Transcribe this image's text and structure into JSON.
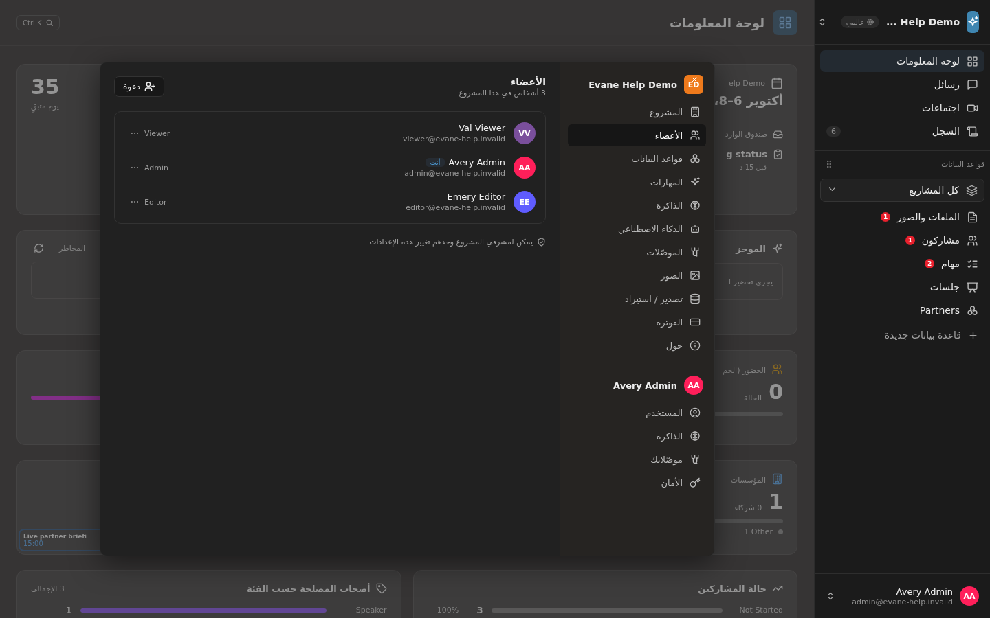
{
  "sidebar": {
    "workspace_name": "... Help Demo",
    "scope_badge": "عالمي",
    "nav": [
      {
        "label": "لوحة المعلومات",
        "selected": true
      },
      {
        "label": "رسائل",
        "selected": false
      },
      {
        "label": "اجتماعات",
        "selected": false
      },
      {
        "label": "السجل",
        "selected": false,
        "count": "6"
      }
    ],
    "databases_title": "قواعد البيانات",
    "project_filter": "كل المشاريع",
    "databases": [
      {
        "label": "الملفات والصور",
        "badge": "1"
      },
      {
        "label": "مشاركون",
        "badge": "1"
      },
      {
        "label": "مهام",
        "badge": "2"
      },
      {
        "label": "جلسات"
      },
      {
        "label": "Partners"
      }
    ],
    "new_database": "قاعدة بيانات جديدة",
    "user": {
      "initials": "AA",
      "name": "Avery Admin",
      "email": "admin@evane-help.invalid"
    }
  },
  "header": {
    "title": "لوحة المعلومات",
    "shortcut": "Ctrl K"
  },
  "dashboard": {
    "countdown": {
      "value": "35",
      "label": "يوم متبقٍ"
    },
    "event": {
      "project": "elp Demo",
      "dates": "أكتوبر 6–8،",
      "inbox": "صندوق الوارد",
      "status": "g status",
      "time": "قبل 15 د"
    },
    "risks": {
      "title": "المخاطر"
    },
    "brief": {
      "title": "الموجز",
      "text": "يجري تحضير ا"
    },
    "attendance": {
      "title": "الحضور (الجم",
      "value": "0",
      "label": "الحالة"
    },
    "organizations": {
      "title": "المؤسسات",
      "value": "1",
      "label": "0 شركاء",
      "legend": "1 Other"
    },
    "meeting": {
      "title": "Live partner briefi",
      "time": "15:00"
    },
    "stakeholders": {
      "title": "أصحاب المصلحة حسب الفئة",
      "total": "3 الإجمالي",
      "rows": [
        {
          "label": "Speaker",
          "count": "1",
          "level": 1
        }
      ]
    },
    "participants": {
      "title": "حالة المشاركين",
      "rows": [
        {
          "label": "Not Started",
          "count": "3",
          "percent": "100%",
          "level": 1
        }
      ]
    }
  },
  "dialog": {
    "workspace": {
      "initials": "ED",
      "name": "Evane Help Demo"
    },
    "project_nav": [
      {
        "label": "المشروع",
        "selected": false
      },
      {
        "label": "الأعضاء",
        "selected": true
      },
      {
        "label": "قواعد البيانات",
        "selected": false
      },
      {
        "label": "المهارات",
        "selected": false
      },
      {
        "label": "الذاكرة",
        "selected": false
      },
      {
        "label": "الذكاء الاصطناعي",
        "selected": false
      },
      {
        "label": "الموصّلات",
        "selected": false
      },
      {
        "label": "الصور",
        "selected": false
      },
      {
        "label": "تصدير / استيراد",
        "selected": false
      },
      {
        "label": "الفوترة",
        "selected": false
      },
      {
        "label": "حول",
        "selected": false
      }
    ],
    "user": {
      "initials": "AA",
      "name": "Avery Admin"
    },
    "user_nav": [
      {
        "label": "المستخدم",
        "selected": false
      },
      {
        "label": "الذاكرة",
        "selected": false
      },
      {
        "label": "موصّلاتك",
        "selected": false
      },
      {
        "label": "الأمان",
        "selected": false
      }
    ],
    "title": "الأعضاء",
    "subtitle": "3 أشخاص في هذا المشروع",
    "invite": "دعوة",
    "members": [
      {
        "initials": "VV",
        "name": "Val Viewer",
        "email": "viewer@evane-help.invalid",
        "role": "Viewer",
        "color": "#7a4f9c"
      },
      {
        "initials": "AA",
        "name": "Avery Admin",
        "email": "admin@evane-help.invalid",
        "role": "Admin",
        "color": "#ff1f5a",
        "you_badge": "أنت"
      },
      {
        "initials": "EE",
        "name": "Emery Editor",
        "email": "editor@evane-help.invalid",
        "role": "Editor",
        "color": "#5f5cff"
      }
    ],
    "note": "يمكن لمشرفي المشروع وحدهم تغيير هذه الإعدادات."
  }
}
